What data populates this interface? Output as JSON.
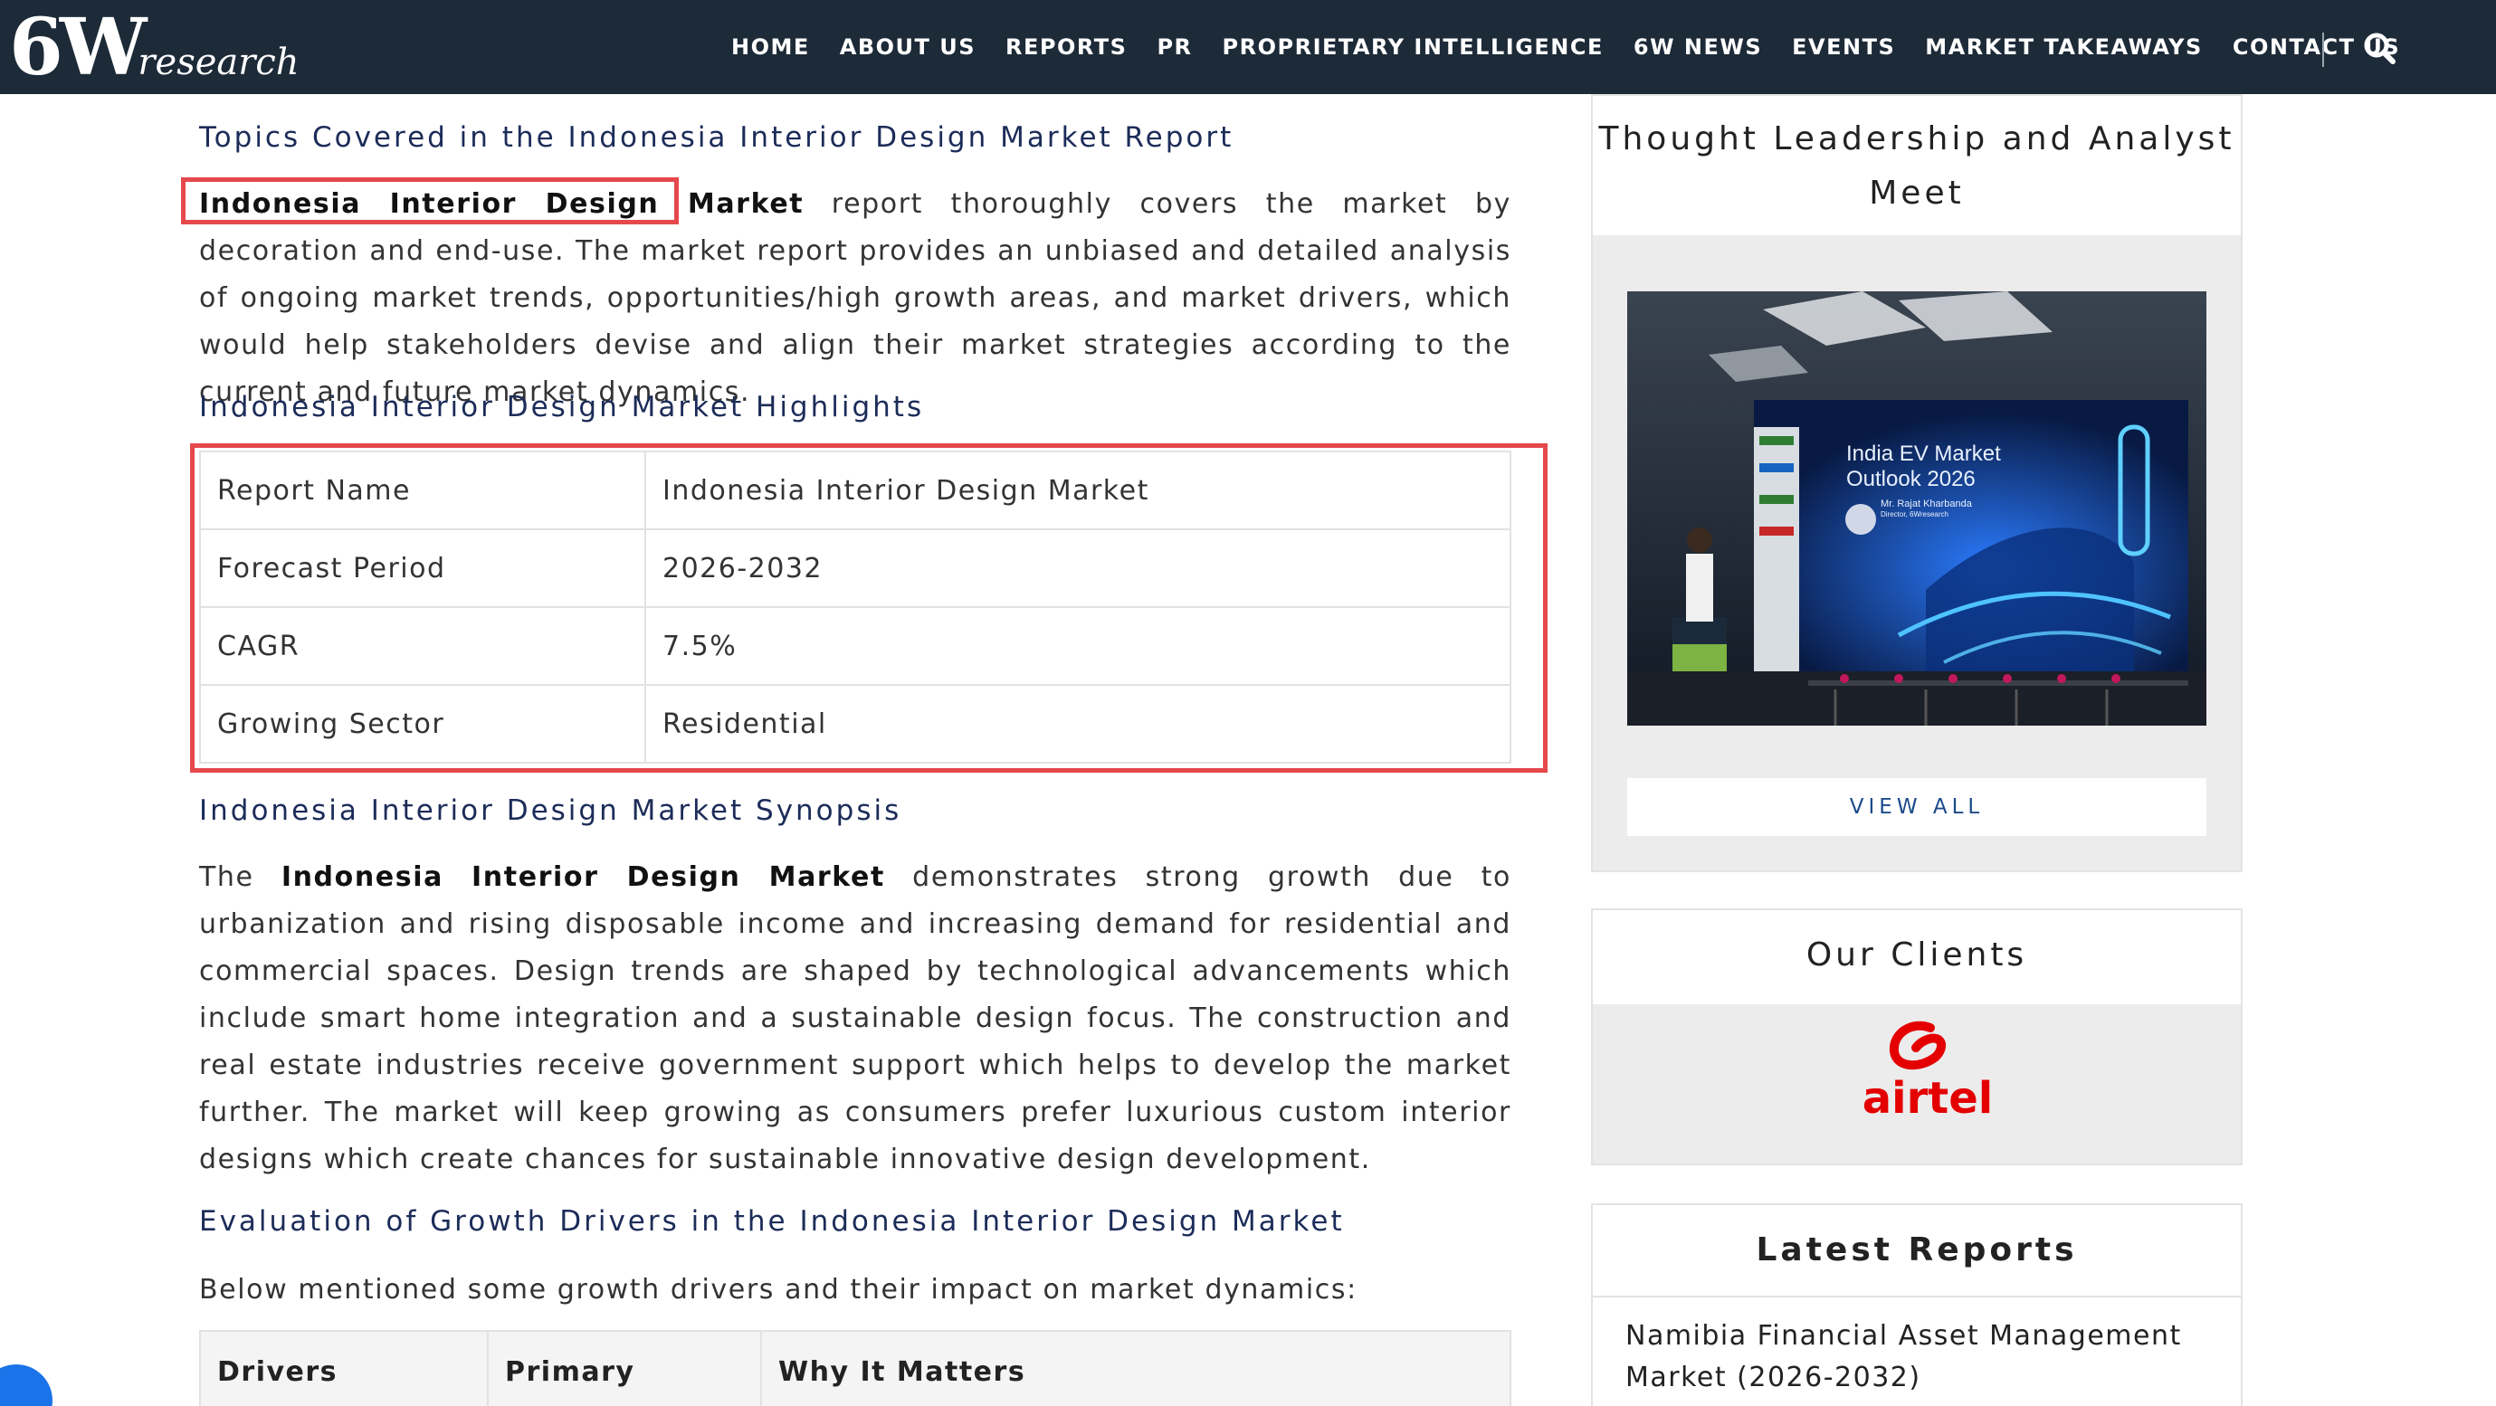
{
  "header": {
    "logo_main": "6W",
    "logo_sub": "research",
    "nav": [
      "HOME",
      "ABOUT US",
      "REPORTS",
      "PR",
      "PROPRIETARY INTELLIGENCE",
      "6W NEWS",
      "EVENTS",
      "MARKET TAKEAWAYS",
      "CONTACT US"
    ]
  },
  "main": {
    "topics_heading": "Topics Covered in the Indonesia Interior Design Market Report",
    "topics_para_bold": "Indonesia Interior Design Market",
    "topics_para_rest": " report thoroughly covers the market by decoration and end-use. The market report provides an unbiased and detailed analysis of ongoing market trends, opportunities/high growth areas, and market drivers, which would help stakeholders devise and align their market strategies according to the current and future market dynamics.",
    "highlights_heading": "Indonesia Interior Design Market Highlights",
    "highlights": [
      {
        "label": "Report Name",
        "value": "Indonesia Interior Design Market"
      },
      {
        "label": "Forecast Period",
        "value": "2026-2032"
      },
      {
        "label": "CAGR",
        "value": "7.5%"
      },
      {
        "label": "Growing Sector",
        "value": "Residential"
      }
    ],
    "synopsis_heading": "Indonesia Interior Design Market Synopsis",
    "synopsis_prefix": "The ",
    "synopsis_bold": "Indonesia Interior Design Market",
    "synopsis_rest": " demonstrates strong growth due to urbanization and rising disposable income and increasing demand for residential and commercial spaces. Design trends are shaped by technological advancements which include smart home integration and a sustainable design focus. The construction and real estate industries receive government support which helps to develop the market further. The market will keep growing as consumers prefer luxurious custom interior designs which create chances for sustainable innovative design development.",
    "drivers_heading": "Evaluation of Growth Drivers in the Indonesia Interior Design Market",
    "drivers_intro": "Below mentioned some growth drivers and their impact on market dynamics:",
    "drivers_table_headers": [
      "Drivers",
      "Primary",
      "Why It Matters"
    ]
  },
  "sidebar": {
    "thought_title": "Thought Leadership and Analyst Meet",
    "photo_screen_line1": "India EV Market",
    "photo_screen_line2": "Outlook 2026",
    "photo_screen_name": "Mr. Rajat Kharbanda",
    "photo_screen_role": "Director, 6Wresearch",
    "view_all": "VIEW ALL",
    "clients_title": "Our Clients",
    "client_logo_text": "airtel",
    "latest_title": "Latest Reports",
    "latest_first": "Namibia Financial Asset Management Market (2026-2032)"
  },
  "colors": {
    "nav_bg": "#1d2a38",
    "heading": "#1c2c59",
    "highlight_border": "#e5484d",
    "airtel_red": "#e40000"
  }
}
